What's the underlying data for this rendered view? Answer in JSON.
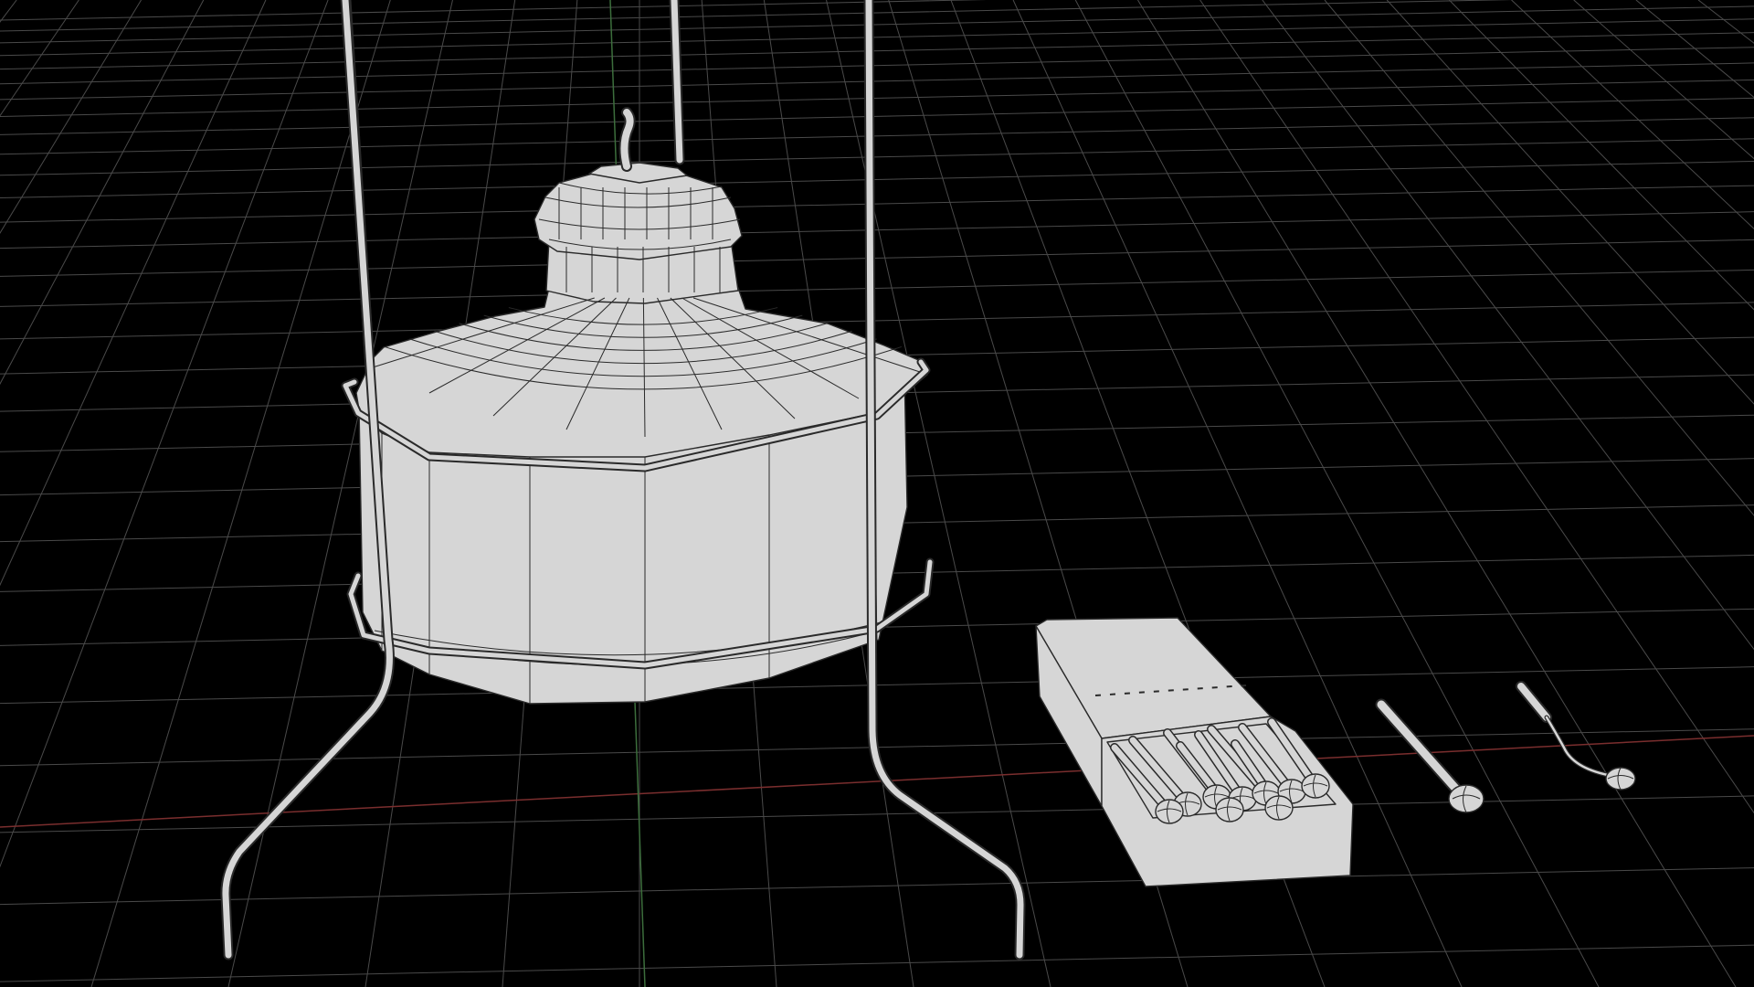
{
  "viewport": {
    "background": "#000000",
    "grid_color": "#4a4a4a",
    "axis_x_color": "#7a2e2e",
    "axis_y_color": "#3c6e3c",
    "model_fill": "#d6d6d6",
    "wire_color": "#2a2a2a"
  },
  "scene_objects": [
    "alcohol-burner",
    "wire-tripod-stand",
    "matchbox",
    "unlit-match",
    "burnt-match"
  ]
}
